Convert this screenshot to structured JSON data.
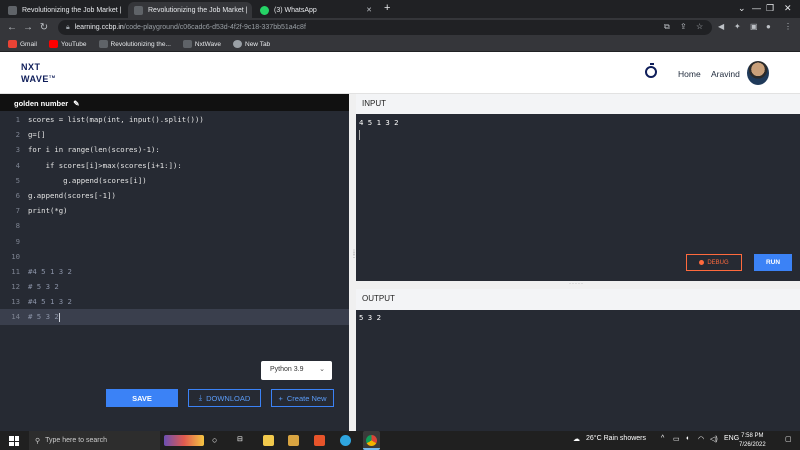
{
  "browser": {
    "tabs": [
      {
        "title": "Revolutionizing the Job Market |",
        "active": false
      },
      {
        "title": "Revolutionizing the Job Market |",
        "active": true
      },
      {
        "title": "(3) WhatsApp",
        "active": false
      }
    ],
    "url_host": "learning.ccbp.in",
    "url_path": "/code-playground/c06cadc6-d53d-4f2f-9c18-337bb51a4c8f",
    "bookmarks": [
      "Gmail",
      "YouTube",
      "Revolutionizing the...",
      "NxtWave",
      "New Tab"
    ]
  },
  "header": {
    "logo_line1": "NXT",
    "logo_line2": "WAVE",
    "logo_tm": "TM",
    "nav_home": "Home",
    "user_name": "Aravind"
  },
  "editor": {
    "title": "golden number",
    "lines": [
      "scores = list(map(int, input().split()))",
      "g=[]",
      "for i in range(len(scores)-1):",
      "    if scores[i]>max(scores[i+1:]):",
      "        g.append(scores[i])",
      "g.append(scores[-1])",
      "print(*g)",
      "",
      "",
      "",
      "#4 5 1 3 2",
      "# 5 3 2",
      "#4 5 1 3 2",
      "# 5 3 2"
    ],
    "line_numbers": [
      "1",
      "2",
      "3",
      "4",
      "5",
      "6",
      "7",
      "8",
      "9",
      "10",
      "11",
      "12",
      "13",
      "14"
    ],
    "current_line": 14,
    "language": "Python 3.9",
    "save_label": "SAVE",
    "download_label": "DOWNLOAD",
    "create_label": "Create New"
  },
  "io": {
    "input_title": "INPUT",
    "input_value": "4 5 1 3 2",
    "debug_label": "DEBUG",
    "run_label": "RUN",
    "output_title": "OUTPUT",
    "output_value": "5 3 2"
  },
  "taskbar": {
    "search_placeholder": "Type here to search",
    "weather": "26°C  Rain showers",
    "time": "7:58 PM",
    "date": "7/26/2022"
  },
  "colors": {
    "accent": "#3b82f6",
    "editor_bg": "#262a33",
    "debug": "#ff6a3d",
    "brand": "#0f1e5a"
  }
}
